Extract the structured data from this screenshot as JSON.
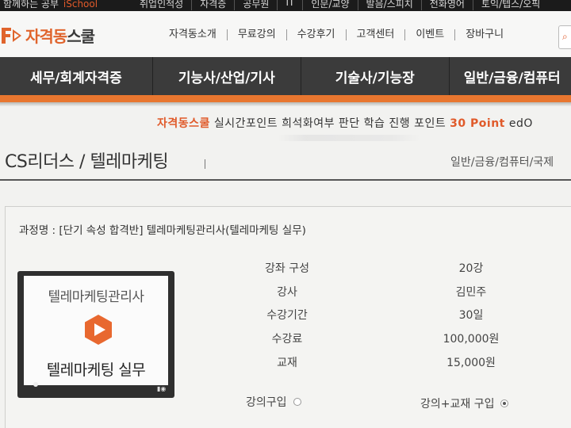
{
  "topbar": {
    "slogan": "함께하는 공부",
    "slogan_brand": "iSchool",
    "links": [
      "취업인적성",
      "자격증",
      "공무원",
      "IT",
      "인문/교양",
      "발음/스피치",
      "전화영어",
      "토익/텝스/오픽"
    ]
  },
  "header": {
    "logo_part1": "자격동",
    "logo_part2": "스쿨",
    "nav": [
      "자격동소개",
      "무료강의",
      "수강후기",
      "고객센터",
      "이벤트",
      "장바구니"
    ]
  },
  "categories": [
    "세무/회계자격증",
    "기능사/산업/기사",
    "기술사/기능장",
    "일반/금융/컴퓨터"
  ],
  "ticker": {
    "brand": "자격동스쿨",
    "text": " 실시간포인트 희석화여부 판단 학습 진행 포인트 ",
    "points": "30 Point",
    "tail": " edO"
  },
  "page": {
    "title": "CS리더스 / 텔레마케팅",
    "breadcrumb": "일반/금융/컴퓨터/국제"
  },
  "course": {
    "name_label": "과정명 : ",
    "name": "[단기 속성 합격반] 텔레마케팅관리사(텔레마케팅 실무)",
    "thumbnail": {
      "line1": "텔레마케팅관리사",
      "line2": "텔레마케팅 실무",
      "play_color": "#e8682f"
    },
    "info": [
      {
        "label": "강좌 구성",
        "value": "20강"
      },
      {
        "label": "강사",
        "value": "김민주"
      },
      {
        "label": "수강기간",
        "value": "30일"
      },
      {
        "label": "수강료",
        "value": "100,000원"
      },
      {
        "label": "교재",
        "value": "15,000원"
      }
    ],
    "purchase_options": [
      {
        "label": "강의구입",
        "selected": false
      },
      {
        "label": "강의+교재 구입",
        "selected": true
      }
    ]
  },
  "colors": {
    "accent": "#e8762f",
    "nav_bg": "#3b3b3b",
    "top_strip": "#1b1b1b"
  }
}
